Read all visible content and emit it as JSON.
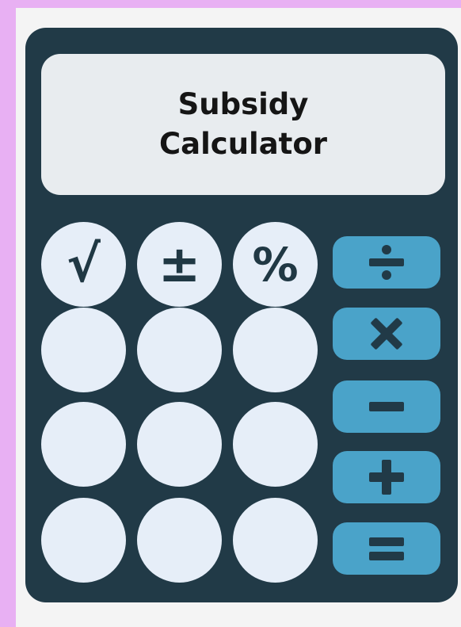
{
  "display": {
    "line1": "Subsidy",
    "line2": "Calculator"
  },
  "function_keys": [
    {
      "label": "√",
      "icon": "square-root-icon"
    },
    {
      "label": "±",
      "icon": "plus-minus-icon"
    },
    {
      "label": "%",
      "icon": "percent-icon"
    }
  ],
  "operator_keys": [
    {
      "icon": "divide-icon"
    },
    {
      "icon": "multiply-icon"
    },
    {
      "icon": "minus-icon"
    },
    {
      "icon": "plus-icon"
    },
    {
      "icon": "equals-icon"
    }
  ],
  "colors": {
    "page_background": "#e8b0f3",
    "calculator_body": "#213a47",
    "display": "#e8ecef",
    "round_key": "#e6eef8",
    "operator_key": "#4aa3c9",
    "operator_symbol": "#213a47"
  }
}
